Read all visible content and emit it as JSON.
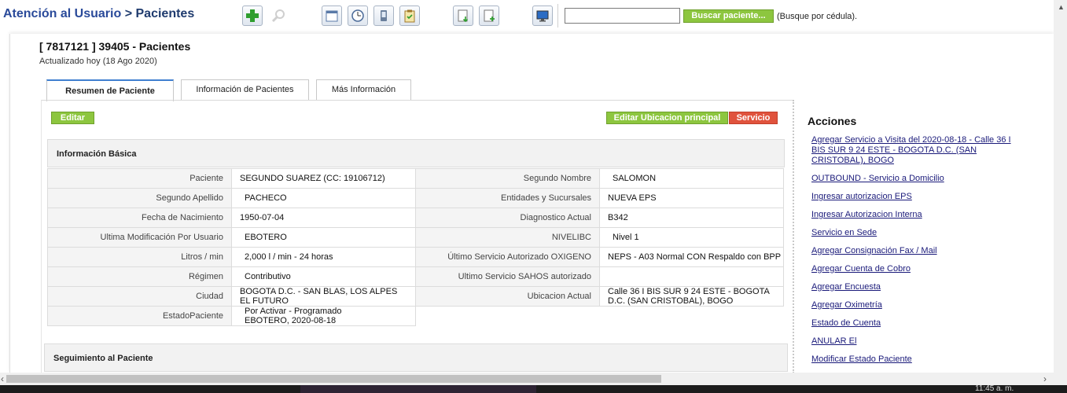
{
  "breadcrumb": {
    "parent": "Atención al Usuario",
    "separator": ">",
    "current": "Pacientes"
  },
  "toolbar": {
    "icons": [
      "add-icon",
      "search-zoom-icon",
      "calendar-icon",
      "clock-icon",
      "mobile-icon",
      "clipboard-icon",
      "download-doc-icon",
      "add-doc-icon",
      "monitor-icon"
    ]
  },
  "search": {
    "value": "",
    "placeholder": "",
    "button_label": "Buscar paciente...",
    "hint": "(Busque por cédula)."
  },
  "record": {
    "title": "[ 7817121 ] 39405 - Pacientes",
    "updated": "Actualizado hoy (18 Ago 2020)"
  },
  "tabs": [
    {
      "label": "Resumen de Paciente",
      "active": true
    },
    {
      "label": "Información de Pacientes",
      "active": false
    },
    {
      "label": "Más Información",
      "active": false
    }
  ],
  "buttons": {
    "edit": "Editar",
    "edit_location": "Editar Ubicacion principal",
    "service": "Servicio"
  },
  "sections": {
    "basic_info": "Información Básica",
    "follow_up": "Seguimiento al Paciente"
  },
  "basic_info": {
    "rows": [
      {
        "l1": "Paciente",
        "v1": "SEGUNDO SUAREZ (CC: 19106712)",
        "l2": "Segundo Nombre",
        "v2": "SALOMON"
      },
      {
        "l1": "Segundo Apellido",
        "v1": "PACHECO",
        "l2": "Entidades y Sucursales",
        "v2": "NUEVA EPS"
      },
      {
        "l1": "Fecha de Nacimiento",
        "v1": "1950-07-04",
        "l2": "Diagnostico Actual",
        "v2": "B342"
      },
      {
        "l1": "Ultima Modificación Por Usuario",
        "v1": "EBOTERO",
        "l2": "NIVELIBC",
        "v2": "Nivel 1"
      },
      {
        "l1": "Litros / min",
        "v1": "2,000 l / min - 24 horas",
        "l2": "Último Servicio Autorizado OXIGENO",
        "v2": "NEPS - A03 Normal CON Respaldo con BPP"
      },
      {
        "l1": "Régimen",
        "v1": "Contributivo",
        "l2": "Ultimo Servicio SAHOS autorizado",
        "v2": ""
      },
      {
        "l1": "Ciudad",
        "v1": "BOGOTA D.C. - SAN BLAS, LOS ALPES EL FUTURO",
        "l2": "Ubicacion Actual",
        "v2": "Calle 36 I BIS SUR 9 24 ESTE - BOGOTA D.C. (SAN CRISTOBAL), BOGO"
      },
      {
        "l1": "EstadoPaciente",
        "v1a": "Por Activar - Programado",
        "v1b": "EBOTERO, 2020-08-18"
      }
    ]
  },
  "actions": {
    "title": "Acciones",
    "links": [
      "Agregar Servicio a Visita del 2020-08-18 - Calle 36 I BIS SUR 9 24 ESTE - BOGOTA D.C. (SAN CRISTOBAL), BOGO",
      "OUTBOUND - Servicio a Domicilio",
      "Ingresar autorizacion EPS",
      "Ingresar Autorizacion Interna",
      "Servicio en Sede",
      "Agregar Consignación Fax / Mail",
      "Agregar Cuenta de Cobro",
      "Agregar Encuesta",
      "Agregar Oximetría",
      "Estado de Cuenta",
      "ANULAR El",
      "Modificar Estado Paciente"
    ]
  },
  "taskbar": {
    "clock": "11:45 a. m."
  },
  "colors": {
    "accent_green": "#8dc63f",
    "accent_red": "#e0533d",
    "link": "#1a1a7a",
    "title_blue": "#1f3b6e"
  }
}
